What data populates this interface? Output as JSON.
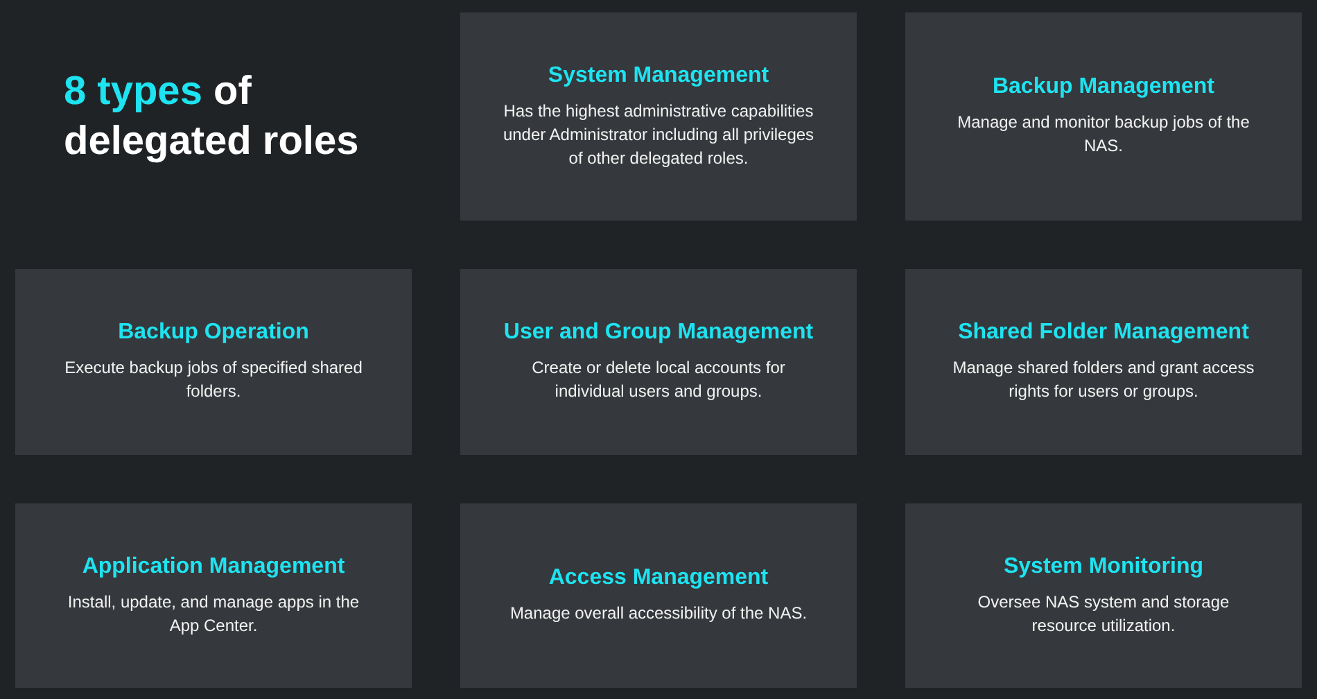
{
  "heading": {
    "highlight": "8 types",
    "rest": "of delegated roles"
  },
  "roles": [
    {
      "title": "System Management",
      "description": "Has the highest administrative capabilities under Administrator including all privileges of other delegated roles."
    },
    {
      "title": "Backup Management",
      "description": "Manage and monitor backup jobs of the NAS."
    },
    {
      "title": "Backup Operation",
      "description": "Execute backup jobs of specified shared folders."
    },
    {
      "title": "User and Group Management",
      "description": "Create or delete local accounts for individual users and groups."
    },
    {
      "title": "Shared Folder Management",
      "description": "Manage shared folders and grant access rights for users or groups."
    },
    {
      "title": "Application Management",
      "description": "Install, update, and manage apps in the App Center."
    },
    {
      "title": "Access Management",
      "description": "Manage overall accessibility of the NAS."
    },
    {
      "title": "System Monitoring",
      "description": "Oversee NAS system and storage resource utilization."
    }
  ]
}
